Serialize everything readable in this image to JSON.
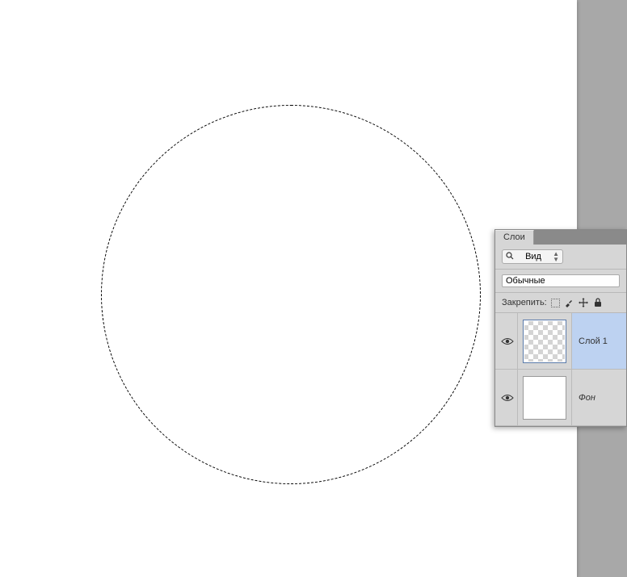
{
  "panel": {
    "tab_label": "Слои",
    "filter_label": "Вид",
    "blend_mode": "Обычные",
    "lock_label": "Закрепить:"
  },
  "layers": [
    {
      "name": "Слой 1",
      "selected": true,
      "visible": true,
      "thumb": "transparent"
    },
    {
      "name": "Фон",
      "selected": false,
      "visible": true,
      "thumb": "white",
      "italic": true
    }
  ]
}
